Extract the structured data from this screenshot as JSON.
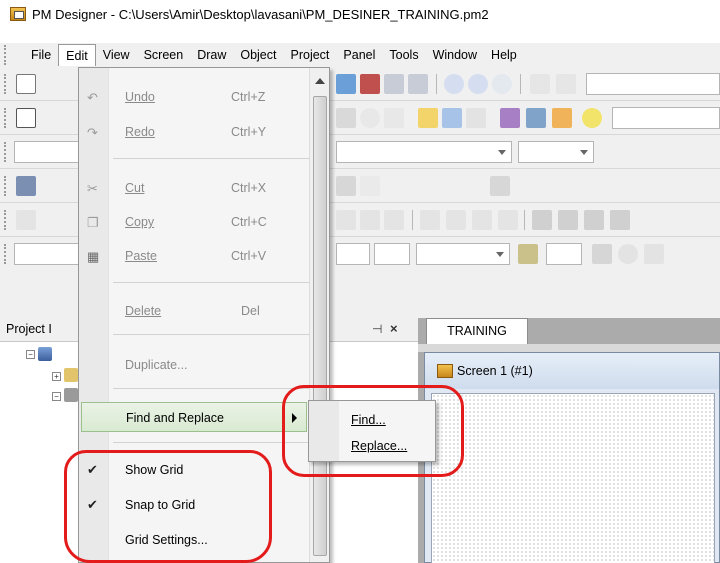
{
  "window": {
    "title": "PM Designer - C:\\Users\\Amir\\Desktop\\lavasani\\PM_DESINER_TRAINING.pm2"
  },
  "menubar": {
    "items": [
      "File",
      "Edit",
      "View",
      "Screen",
      "Draw",
      "Object",
      "Project",
      "Panel",
      "Tools",
      "Window",
      "Help"
    ],
    "active": "Edit"
  },
  "edit_menu": {
    "undo": {
      "label": "Undo",
      "shortcut": "Ctrl+Z"
    },
    "redo": {
      "label": "Redo",
      "shortcut": "Ctrl+Y"
    },
    "cut": {
      "label": "Cut",
      "shortcut": "Ctrl+X"
    },
    "copy": {
      "label": "Copy",
      "shortcut": "Ctrl+C"
    },
    "paste": {
      "label": "Paste",
      "shortcut": "Ctrl+V"
    },
    "delete": {
      "label": "Delete",
      "shortcut": "Del"
    },
    "duplicate": {
      "label": "Duplicate..."
    },
    "find_replace": {
      "label": "Find and Replace"
    },
    "show_grid": {
      "label": "Show Grid",
      "checked": true
    },
    "snap_to_grid": {
      "label": "Snap to Grid",
      "checked": true
    },
    "grid_settings": {
      "label": "Grid Settings..."
    }
  },
  "submenu": {
    "find": "Find...",
    "replace": "Replace..."
  },
  "project_panel": {
    "title": "Project I"
  },
  "document": {
    "tab": "TRAINING",
    "screen_title": "Screen 1 (#1)"
  },
  "icons": {
    "check": "checkmark-icon",
    "submenu": "chevron-right-icon",
    "pin": "pin-icon",
    "close": "close-icon"
  },
  "colors": {
    "annotation": "#e31b1b",
    "highlight_border": "#9cc08d",
    "menu_bg": "#f5f5f5"
  }
}
